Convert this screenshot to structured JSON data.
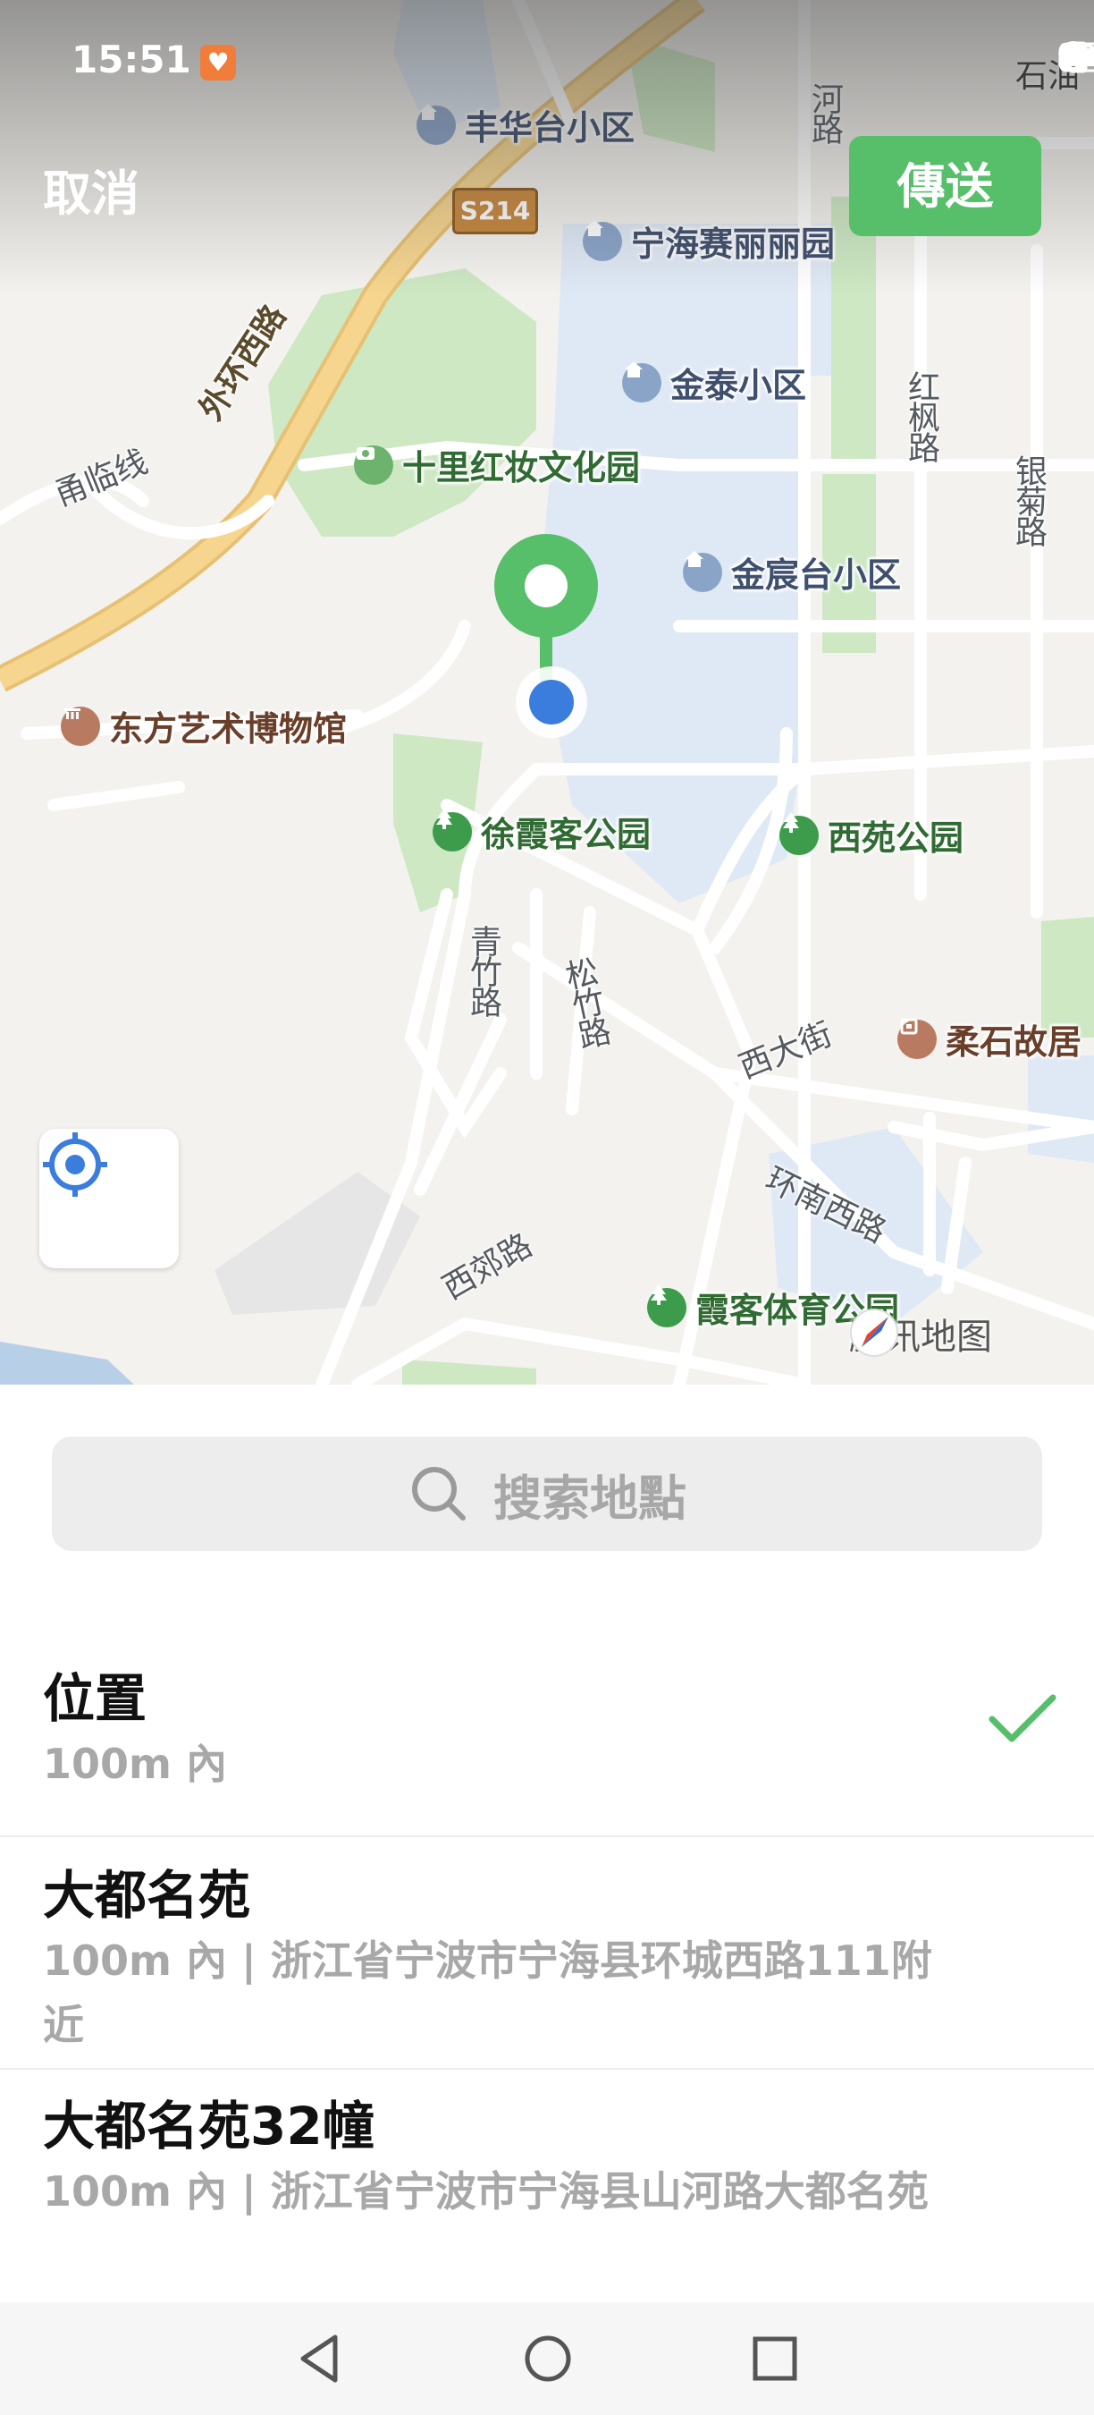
{
  "status_bar": {
    "time": "15:51",
    "icons": [
      "app-notification-icon",
      "location-icon",
      "vibrate-icon",
      "wifi-icon",
      "alert-icon",
      "battery-icon"
    ]
  },
  "header": {
    "cancel_label": "取消",
    "send_label": "傳送"
  },
  "map": {
    "pois": [
      {
        "name": "丰华台小区",
        "type": "residential"
      },
      {
        "name": "宁海赛丽丽园",
        "type": "residential"
      },
      {
        "name": "金泰小区",
        "type": "residential"
      },
      {
        "name": "十里红妆文化园",
        "type": "scenic"
      },
      {
        "name": "金宸台小区",
        "type": "residential"
      },
      {
        "name": "东方艺术博物馆",
        "type": "museum"
      },
      {
        "name": "徐霞客公园",
        "type": "park"
      },
      {
        "name": "西苑公园",
        "type": "park"
      },
      {
        "name": "柔石故居",
        "type": "museum"
      },
      {
        "name": "霞客体育公园",
        "type": "park"
      }
    ],
    "roads": {
      "s214": "S214",
      "waihuan_xilu": "外环西路",
      "yonglin_xian": "甬临线",
      "hong_feng_lu": "红枫路",
      "yin_ju_lu": "银菊路",
      "qing_zhu_lu": "青竹路",
      "song_zhu_lu": "松竹路",
      "xi_da_jie": "西大街",
      "huan_nan_xilu": "环南西路",
      "xi_jiao_lu": "西郊路",
      "he_lu": "河路",
      "shi_you": "石油"
    },
    "attribution": "腾讯地图",
    "colors": {
      "pin": "#57be6a",
      "current_location": "#3b7ddd",
      "highway": "#f4c97a",
      "green_area": "#cde8c3",
      "water": "#dde8f4"
    }
  },
  "search": {
    "placeholder": "搜索地點"
  },
  "locations": [
    {
      "title": "位置",
      "subtitle": "100m 內",
      "selected": true
    },
    {
      "title": "大都名苑",
      "subtitle": "100m 內 | 浙江省宁波市宁海县环城西路111附近",
      "selected": false
    },
    {
      "title": "大都名苑32幢",
      "subtitle": "100m 內 | 浙江省宁波市宁海县山河路大都名苑",
      "selected": false
    }
  ],
  "nav_bar": {
    "buttons": [
      "back-icon",
      "home-icon",
      "recents-icon"
    ]
  },
  "accent_color": "#57be6a"
}
